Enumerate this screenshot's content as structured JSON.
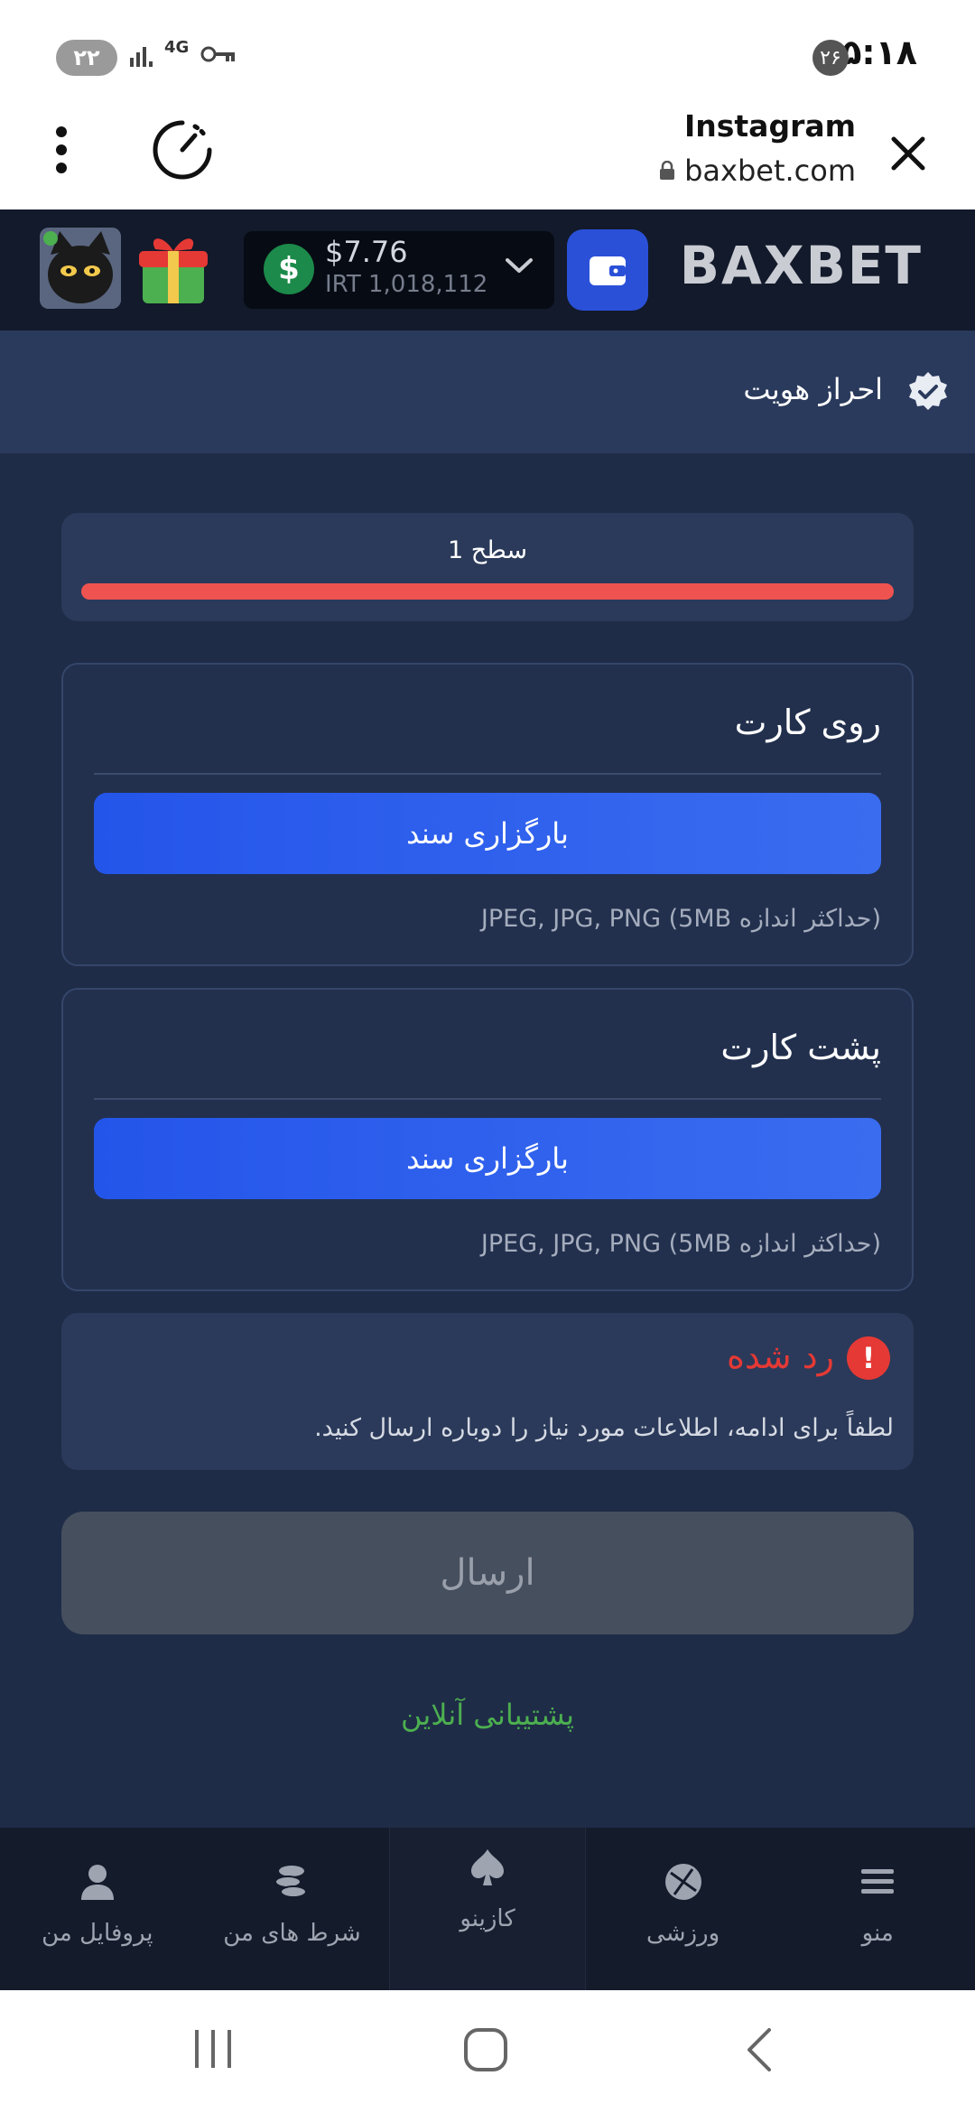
{
  "status_bar": {
    "time": "۱۵:۱۸",
    "notification_count": "۲۶",
    "battery": "۲۲",
    "network": "4G"
  },
  "browser": {
    "title": "Instagram",
    "url": "baxbet.com"
  },
  "site_header": {
    "logo": "BAXBET",
    "balance_usd": "$7.76",
    "balance_irt": "IRT 1,018,112"
  },
  "page": {
    "title": "احراز هویت"
  },
  "level": {
    "label": "سطح 1",
    "progress": 1.0,
    "color": "#ef5350"
  },
  "front_card": {
    "title": "روی کارت",
    "upload_label": "بارگزاری سند",
    "hint": "(حداکثر اندازه 5MB) JPEG, JPG, PNG"
  },
  "back_card": {
    "title": "پشت کارت",
    "upload_label": "بارگزاری سند",
    "hint": "(حداکثر اندازه 5MB) JPEG, JPG, PNG"
  },
  "rejected": {
    "title": "رد شده",
    "message": "لطفاً برای ادامه، اطلاعات مورد نیاز را دوباره ارسال کنید.",
    "color": "#e53935"
  },
  "submit_label": "ارسال",
  "support_label": "پشتیبانی آنلاین",
  "bottom_nav": {
    "menu": "منو",
    "sports": "ورزشی",
    "casino": "کازینو",
    "my_bets": "شرط های من",
    "profile": "پروفایل من"
  }
}
